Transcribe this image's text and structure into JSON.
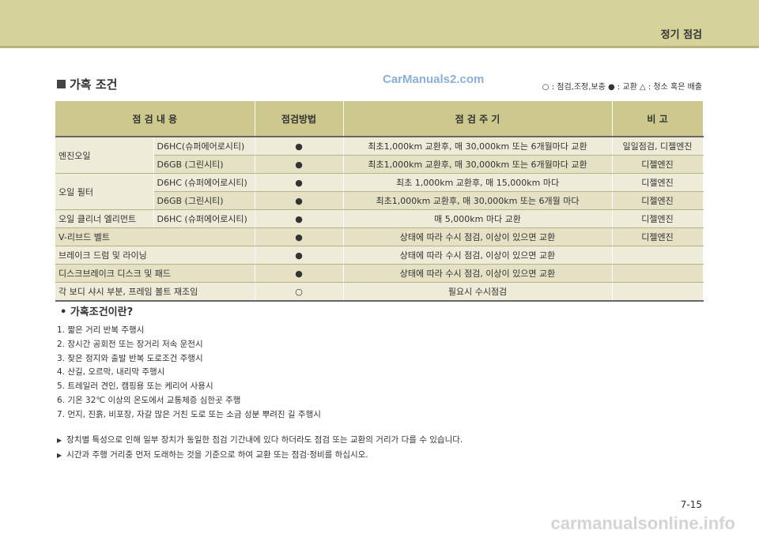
{
  "header": {
    "chapter_title": "정기 점검"
  },
  "section": {
    "title": "가혹 조건",
    "watermark": "CarManuals2.com"
  },
  "legend": "○ : 점검,조정,보충  ● : 교환  △ : 청소 혹은 배출",
  "table": {
    "headers": [
      "점   검   내   용",
      "점검방법",
      "점   검   주   기",
      "비   고"
    ],
    "rows": [
      {
        "item": "엔진오일",
        "sub": "D6HC(슈퍼에어로시티)",
        "method": "●",
        "period": "최초1,000km 교환후, 매 30,000km 또는 6개월마다 교환",
        "note": "일일점검, 디젤엔진"
      },
      {
        "item": "",
        "sub": "D6GB (그린시티)",
        "method": "●",
        "period": "최초1,000km 교환후, 매 30,000km 또는 6개월마다 교환",
        "note": "디젤엔진"
      },
      {
        "item": "오일 필터",
        "sub": "D6HC (슈퍼에어로시티)",
        "method": "●",
        "period": "최초 1,000km 교환후, 매 15,000km 마다",
        "note": "디젤엔진"
      },
      {
        "item": "",
        "sub": "D6GB (그린시티)",
        "method": "●",
        "period": "최초1,000km 교환후, 매 30,000km 또는 6개월 마다",
        "note": "디젤엔진"
      },
      {
        "item": "오일 클리너 엘리먼트",
        "sub": "D6HC (슈퍼에어로시티)",
        "method": "●",
        "period": "매 5,000km 마다 교환",
        "note": "디젤엔진"
      },
      {
        "item": "V-리브드 벨트",
        "method": "●",
        "period": "상태에 따라 수시 점검, 이상이 있으면 교환",
        "note": "디젤엔진"
      },
      {
        "item": "브레이크 드럼 및 라이닝",
        "method": "●",
        "period": "상태에 따라 수시 점검, 이상이 있으면 교환",
        "note": ""
      },
      {
        "item": "디스크브레이크 디스크 및 패드",
        "method": "●",
        "period": "상태에 따라 수시 점검, 이상이 있으면 교환",
        "note": ""
      },
      {
        "item": "각 보디 샤시 부분, 프레임 볼트 재조임",
        "method": "○",
        "period": "필요시 수시점검",
        "note": ""
      }
    ]
  },
  "conditions": {
    "heading": "가혹조건이란?",
    "items": [
      "1. 짧은 거리 반복 주행시",
      "2. 장시간 공회전 또는 장거리 저속 운전시",
      "3. 잦은 정지와 출발 반복 도로조건 주행시",
      "4. 산길, 오르막, 내리막 주행시",
      "5. 트레일러 견인, 캠핑용 또는 케리어 사용시",
      "6. 기온 32℃ 이상의 온도에서 교통체증 심한곳 주행",
      "7. 먼지, 진흙, 비포장, 자갈 많은 거친 도로   또는 소금  성분 뿌려진 길 주행시"
    ]
  },
  "notes": [
    "장치별 특성으로 인해 일부 장치가 동일한 점검 기간내에 있다 하더라도 점검 또는 교환의 거리가 다를 수 있습니다.",
    "시간과 주행 거리중 먼저 도래하는 것을 기준으로 하여 교환 또는 점검·정비를 하십시오."
  ],
  "page_number": "7-15",
  "footer_watermark": "carmanualsonline.info"
}
